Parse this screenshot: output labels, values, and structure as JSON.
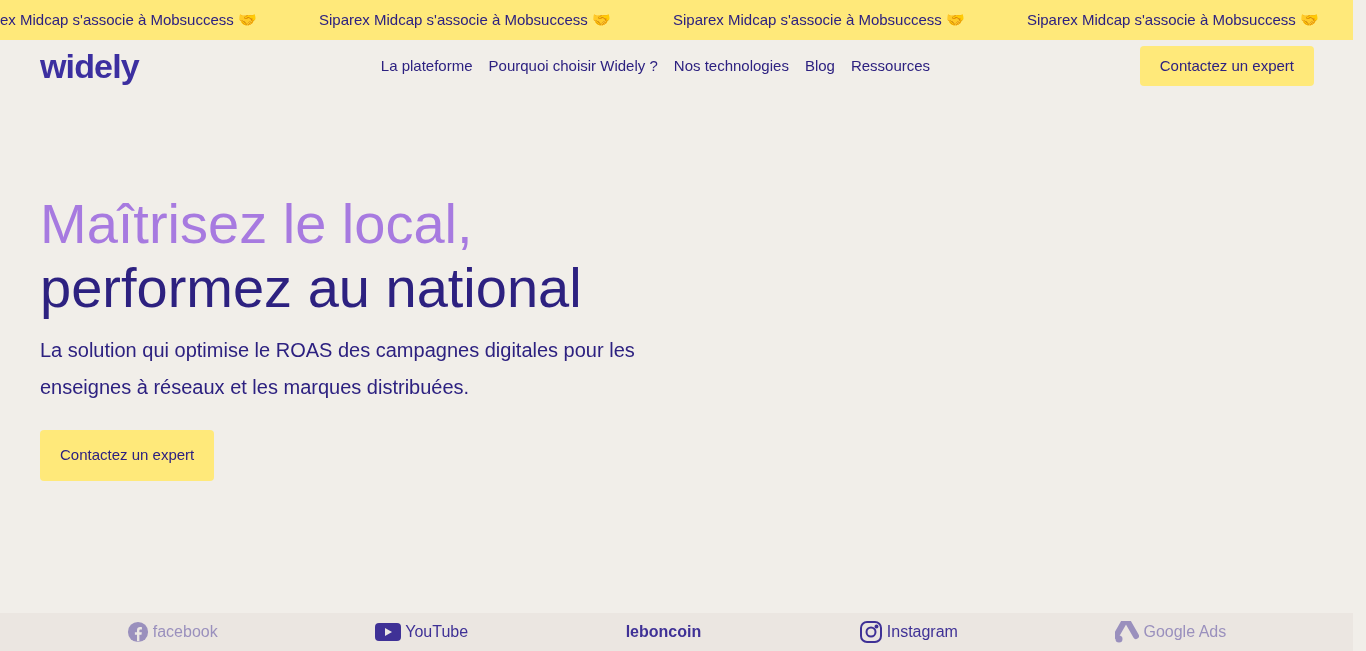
{
  "ticker": [
    "ex Midcap s'associe à Mobsuccess 🤝",
    "Siparex Midcap s'associe à Mobsuccess 🤝",
    "Siparex Midcap s'associe à Mobsuccess 🤝",
    "Siparex Midcap s'associe à Mobsuccess 🤝"
  ],
  "logo": "widely",
  "nav": [
    "La plateforme",
    "Pourquoi choisir Widely ?",
    "Nos technologies",
    "Blog",
    "Ressources"
  ],
  "header_button": "Contactez un expert",
  "hero": {
    "title_line_1": "Maîtrisez le local,",
    "title_line_2": "performez au national",
    "subtitle": "La solution qui optimise le ROAS des campagnes digitales pour les enseignes à réseaux et les marques distribuées.",
    "button": "Contactez un expert"
  },
  "partners": [
    {
      "kind": "facebook",
      "name": "facebook",
      "dimmed": true
    },
    {
      "kind": "youtube",
      "name": "YouTube",
      "dimmed": false
    },
    {
      "kind": "plain",
      "name": "leboncoin",
      "dimmed": false
    },
    {
      "kind": "instagram",
      "name": "Instagram",
      "dimmed": false
    },
    {
      "kind": "ads",
      "name": "Google Ads",
      "dimmed": true
    }
  ]
}
